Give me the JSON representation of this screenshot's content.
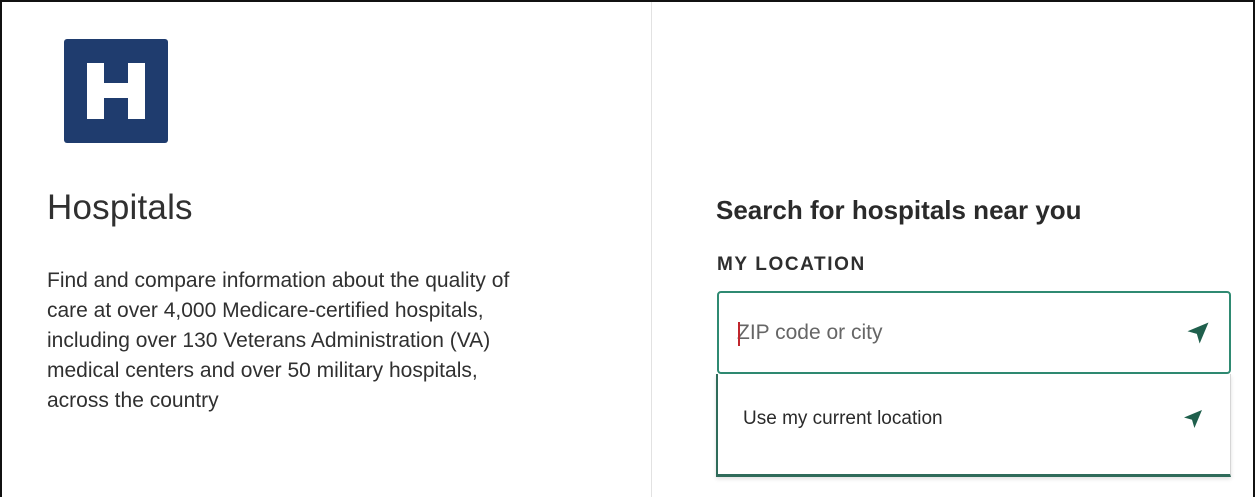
{
  "hospital_card": {
    "logo_icon": "hospital-h-icon",
    "logo_letter": "H",
    "logo_color": "#1f3c6e",
    "title": "Hospitals",
    "description": "Find and compare information about the quality of care at over 4,000 Medicare-certified hospitals, including over 130 Veterans Administration (VA) medical centers and over 50 military hospitals, across the country"
  },
  "search": {
    "heading": "Search for hospitals near you",
    "location_label": "MY LOCATION",
    "input_value": "",
    "input_placeholder": "ZIP code or city",
    "locate_icon": "navigation-arrow-icon",
    "accent_color": "#2f8a72"
  },
  "dropdown": {
    "items": [
      {
        "label": "Use my current location",
        "icon": "navigation-arrow-icon"
      }
    ]
  }
}
